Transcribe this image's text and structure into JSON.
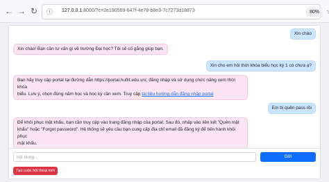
{
  "browser": {
    "url_host": "127.0.0.1",
    "url_rest": ":8000/?c=2e190569-647f-4e78-b8e3-7c7273d18873",
    "zoom": "80%"
  },
  "messages": [
    {
      "role": "user",
      "text": "Xin chào"
    },
    {
      "role": "bot",
      "text": "Xin chào! Bạn cần tư vấn gì về trường Đại học? Tôi sẽ cố gắng giúp bạn."
    },
    {
      "role": "user",
      "text": "Xin cho em hỏi thời khóa biểu học kỳ 1 có chưa ạ?"
    },
    {
      "role": "bot",
      "line1": "Bạn hãy truy cập portal tại đường dẫn https://portal.huflit.edu.vn/, đăng nhập và sử dụng chức năng xem thời khóa",
      "line2_prefix": "biểu. Lưu ý, chọn đúng năm học và học kỳ cần xem. Truy cập ",
      "link_text": "tài liệu hướng dẫn đăng nhập portal"
    },
    {
      "role": "user",
      "text": "Em bị quên pass rồi"
    },
    {
      "role": "bot",
      "line1": "Để khôi phục mật khẩu, bạn cần truy cập vào trang đăng nhập của portal. Sau đó, nhấp vào liên kết \"Quên mật",
      "line2": "khẩu\" hoặc \"Forgot password\". Hệ thống sẽ yêu cầu bạn cung cấp địa chỉ email đã đăng ký để tiến hành khôi phục",
      "line3": "mật khẩu."
    }
  ],
  "composer": {
    "placeholder": "nội dung...",
    "value": "",
    "send_label": "Gởi",
    "new_chat_label": "Tạo cuộc hội thoại mới"
  },
  "icons": {
    "back": "back-arrow-icon",
    "forward": "forward-arrow-icon",
    "reload": "reload-icon",
    "site_info": "site-info-icon",
    "bookmark": "bookmark-star-icon"
  },
  "colors": {
    "user_bubble": "#cce5ff",
    "bot_bubble": "#fbe4f1",
    "send_button": "#0d6efd",
    "new_chat_button": "#dc3545"
  }
}
